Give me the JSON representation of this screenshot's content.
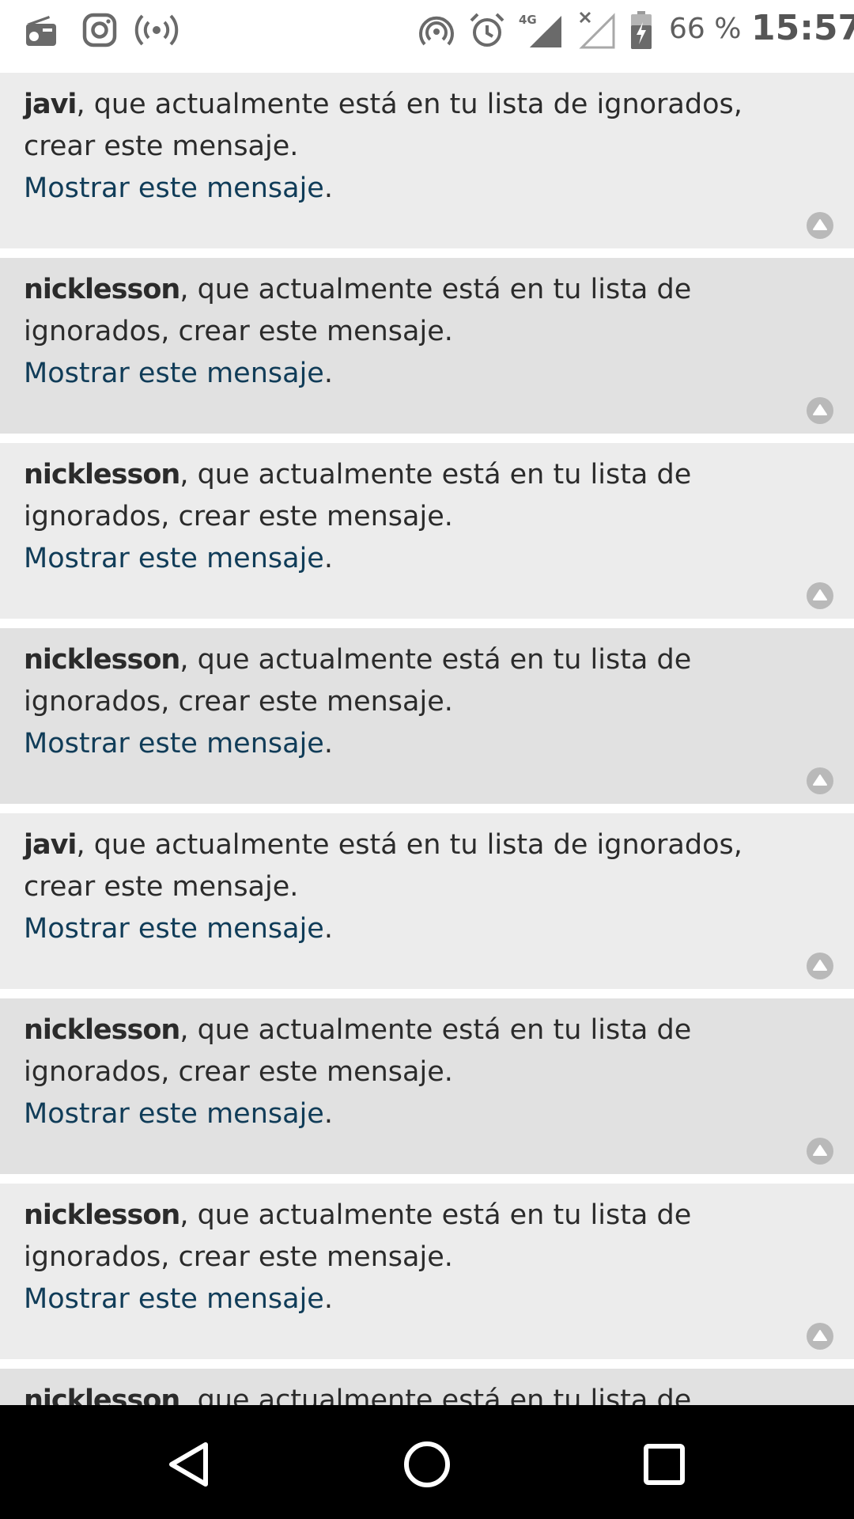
{
  "status_bar": {
    "icons": [
      "radio-icon",
      "instagram-icon",
      "broadcast-icon",
      "hotspot-icon",
      "alarm-icon",
      "signal-4g-icon",
      "no-signal-icon",
      "battery-charging-icon"
    ],
    "network_label": "4G",
    "battery_percent": "66 %",
    "time": "15:57"
  },
  "messages": [
    {
      "author": "javi",
      "text": ", que actualmente está en tu lista de ignorados, crear este mensaje.",
      "link": "Mostrar este mensaje",
      "period": "."
    },
    {
      "author": "nicklesson",
      "text": ", que actualmente está en tu lista de ignorados, crear este mensaje.",
      "link": "Mostrar este mensaje",
      "period": "."
    },
    {
      "author": "nicklesson",
      "text": ", que actualmente está en tu lista de ignorados, crear este mensaje.",
      "link": "Mostrar este mensaje",
      "period": "."
    },
    {
      "author": "nicklesson",
      "text": ", que actualmente está en tu lista de ignorados, crear este mensaje.",
      "link": "Mostrar este mensaje",
      "period": "."
    },
    {
      "author": "javi",
      "text": ", que actualmente está en tu lista de ignorados, crear este mensaje.",
      "link": "Mostrar este mensaje",
      "period": "."
    },
    {
      "author": "nicklesson",
      "text": ", que actualmente está en tu lista de ignorados, crear este mensaje.",
      "link": "Mostrar este mensaje",
      "period": "."
    },
    {
      "author": "nicklesson",
      "text": ", que actualmente está en tu lista de ignorados, crear este mensaje.",
      "link": "Mostrar este mensaje",
      "period": "."
    },
    {
      "author": "nicklesson",
      "text": ", que actualmente está en tu lista de ignorados,",
      "link": "",
      "period": ""
    }
  ],
  "nav_bar": {
    "icons": [
      "back-icon",
      "home-icon",
      "recents-icon"
    ]
  },
  "colors": {
    "row_light": "#ececec",
    "row_dark": "#e1e1e1",
    "link": "#103c58",
    "text": "#2b2b2b"
  }
}
